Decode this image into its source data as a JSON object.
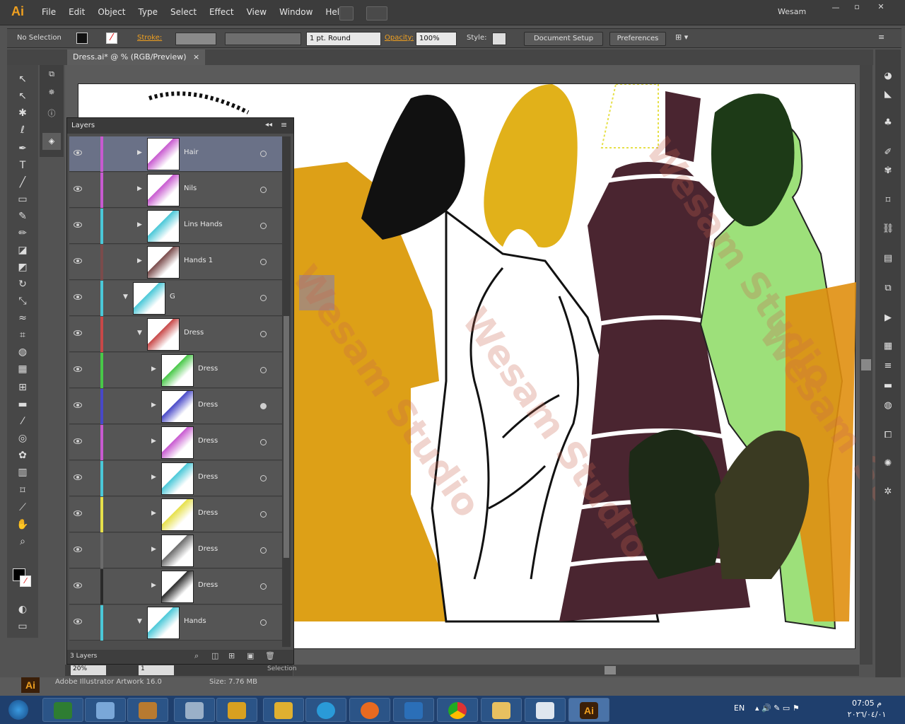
{
  "app": {
    "logo": "Ai",
    "user": "Wesam"
  },
  "menu": [
    "File",
    "Edit",
    "Object",
    "Type",
    "Select",
    "Effect",
    "View",
    "Window",
    "Help"
  ],
  "control": {
    "selection": "No Selection",
    "stroke_label": "Stroke:",
    "stroke_profile": "1 pt. Round",
    "opacity_label": "Opacity:",
    "opacity_value": "100%",
    "style_label": "Style:",
    "document_setup": "Document Setup",
    "preferences": "Preferences"
  },
  "document": {
    "tab": "Dress.ai* @ % (RGB/Preview)"
  },
  "layers_panel": {
    "title": "Layers",
    "footer": "3 Layers",
    "rows": [
      {
        "name": "Hair",
        "color": "#c85ad0",
        "indent": 1,
        "expanded": false,
        "selected": true,
        "target": false
      },
      {
        "name": "Nils",
        "color": "#c85ad0",
        "indent": 1,
        "expanded": false,
        "selected": false,
        "target": false
      },
      {
        "name": "Lins Hands",
        "color": "#4ac8d8",
        "indent": 1,
        "expanded": false,
        "selected": false,
        "target": false
      },
      {
        "name": "Hands 1",
        "color": "#7a4b4b",
        "indent": 1,
        "expanded": false,
        "selected": false,
        "target": false
      },
      {
        "name": "G",
        "color": "#4ac8d8",
        "indent": 0,
        "expanded": true,
        "selected": false,
        "target": false
      },
      {
        "name": "Dress",
        "color": "#c84848",
        "indent": 1,
        "expanded": true,
        "selected": false,
        "target": false
      },
      {
        "name": "Dress",
        "color": "#48c848",
        "indent": 2,
        "expanded": false,
        "selected": false,
        "target": false
      },
      {
        "name": "Dress",
        "color": "#4848c8",
        "indent": 2,
        "expanded": false,
        "selected": false,
        "target": true
      },
      {
        "name": "Dress",
        "color": "#c85ad0",
        "indent": 2,
        "expanded": false,
        "selected": false,
        "target": false
      },
      {
        "name": "Dress",
        "color": "#4ac8d8",
        "indent": 2,
        "expanded": false,
        "selected": false,
        "target": false
      },
      {
        "name": "Dress",
        "color": "#e6e04a",
        "indent": 2,
        "expanded": false,
        "selected": false,
        "target": false
      },
      {
        "name": "Dress",
        "color": "#6b6b6b",
        "indent": 2,
        "expanded": false,
        "selected": false,
        "target": false
      },
      {
        "name": "Dress",
        "color": "#2a2a2a",
        "indent": 2,
        "expanded": false,
        "selected": false,
        "target": false
      },
      {
        "name": "Hands",
        "color": "#4ac8d8",
        "indent": 1,
        "expanded": true,
        "selected": false,
        "target": false
      }
    ]
  },
  "status": {
    "zoom": "20%",
    "page": "1",
    "tool": "Selection"
  },
  "file_info": {
    "name": "Adobe Illustrator Artwork 16.0",
    "size": "Size: 7.76 MB"
  },
  "watermark": "Wesam Studio",
  "taskbar": {
    "lang": "EN",
    "time": "07:05 م",
    "date": "٢٠٢٦/٠٤/٠١"
  }
}
